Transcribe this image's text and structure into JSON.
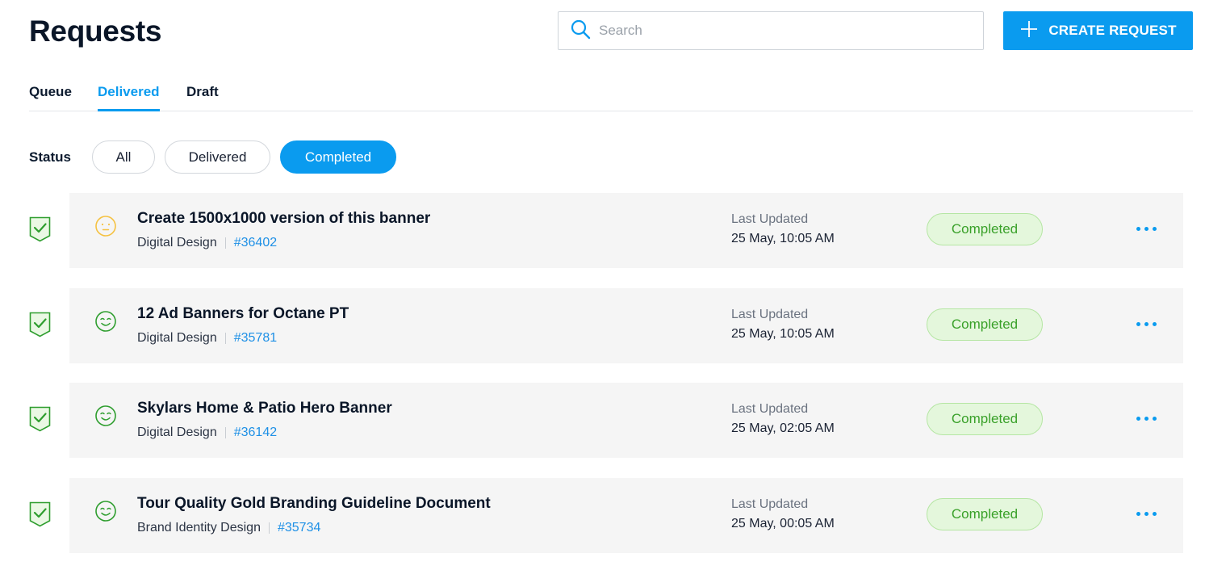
{
  "page": {
    "title": "Requests"
  },
  "search": {
    "placeholder": "Search",
    "value": ""
  },
  "toolbar": {
    "create_label": "CREATE REQUEST"
  },
  "tabs": [
    {
      "label": "Queue",
      "active": false
    },
    {
      "label": "Delivered",
      "active": true
    },
    {
      "label": "Draft",
      "active": false
    }
  ],
  "status_filter": {
    "label": "Status",
    "options": [
      {
        "label": "All",
        "active": false
      },
      {
        "label": "Delivered",
        "active": false
      },
      {
        "label": "Completed",
        "active": true
      }
    ]
  },
  "requests": [
    {
      "title": "Create 1500x1000 version of this banner",
      "category": "Digital Design",
      "id": "#36402",
      "updated_label": "Last Updated",
      "updated_date": "25 May, 10:05 AM",
      "status": "Completed",
      "rating": "neutral-face-icon"
    },
    {
      "title": "12 Ad Banners for Octane PT",
      "category": "Digital Design",
      "id": "#35781",
      "updated_label": "Last Updated",
      "updated_date": "25 May, 10:05 AM",
      "status": "Completed",
      "rating": "happy-face-icon"
    },
    {
      "title": "Skylars Home & Patio Hero Banner",
      "category": "Digital Design",
      "id": "#36142",
      "updated_label": "Last Updated",
      "updated_date": "25 May, 02:05 AM",
      "status": "Completed",
      "rating": "happy-face-icon"
    },
    {
      "title": "Tour Quality Gold Branding Guideline Document",
      "category": "Brand Identity Design",
      "id": "#35734",
      "updated_label": "Last Updated",
      "updated_date": "25 May, 00:05 AM",
      "status": "Completed",
      "rating": "happy-face-icon"
    }
  ],
  "colors": {
    "accent": "#0a9bef",
    "success": "#3aa12a",
    "success_bg": "#e4f7dc",
    "neutral_face": "#f5c242",
    "happy_face": "#2f9e2f"
  },
  "icons": {
    "search": "search-icon",
    "create": "plus-icon",
    "row_check": "check-shield-icon",
    "more": "more-dots-icon"
  }
}
